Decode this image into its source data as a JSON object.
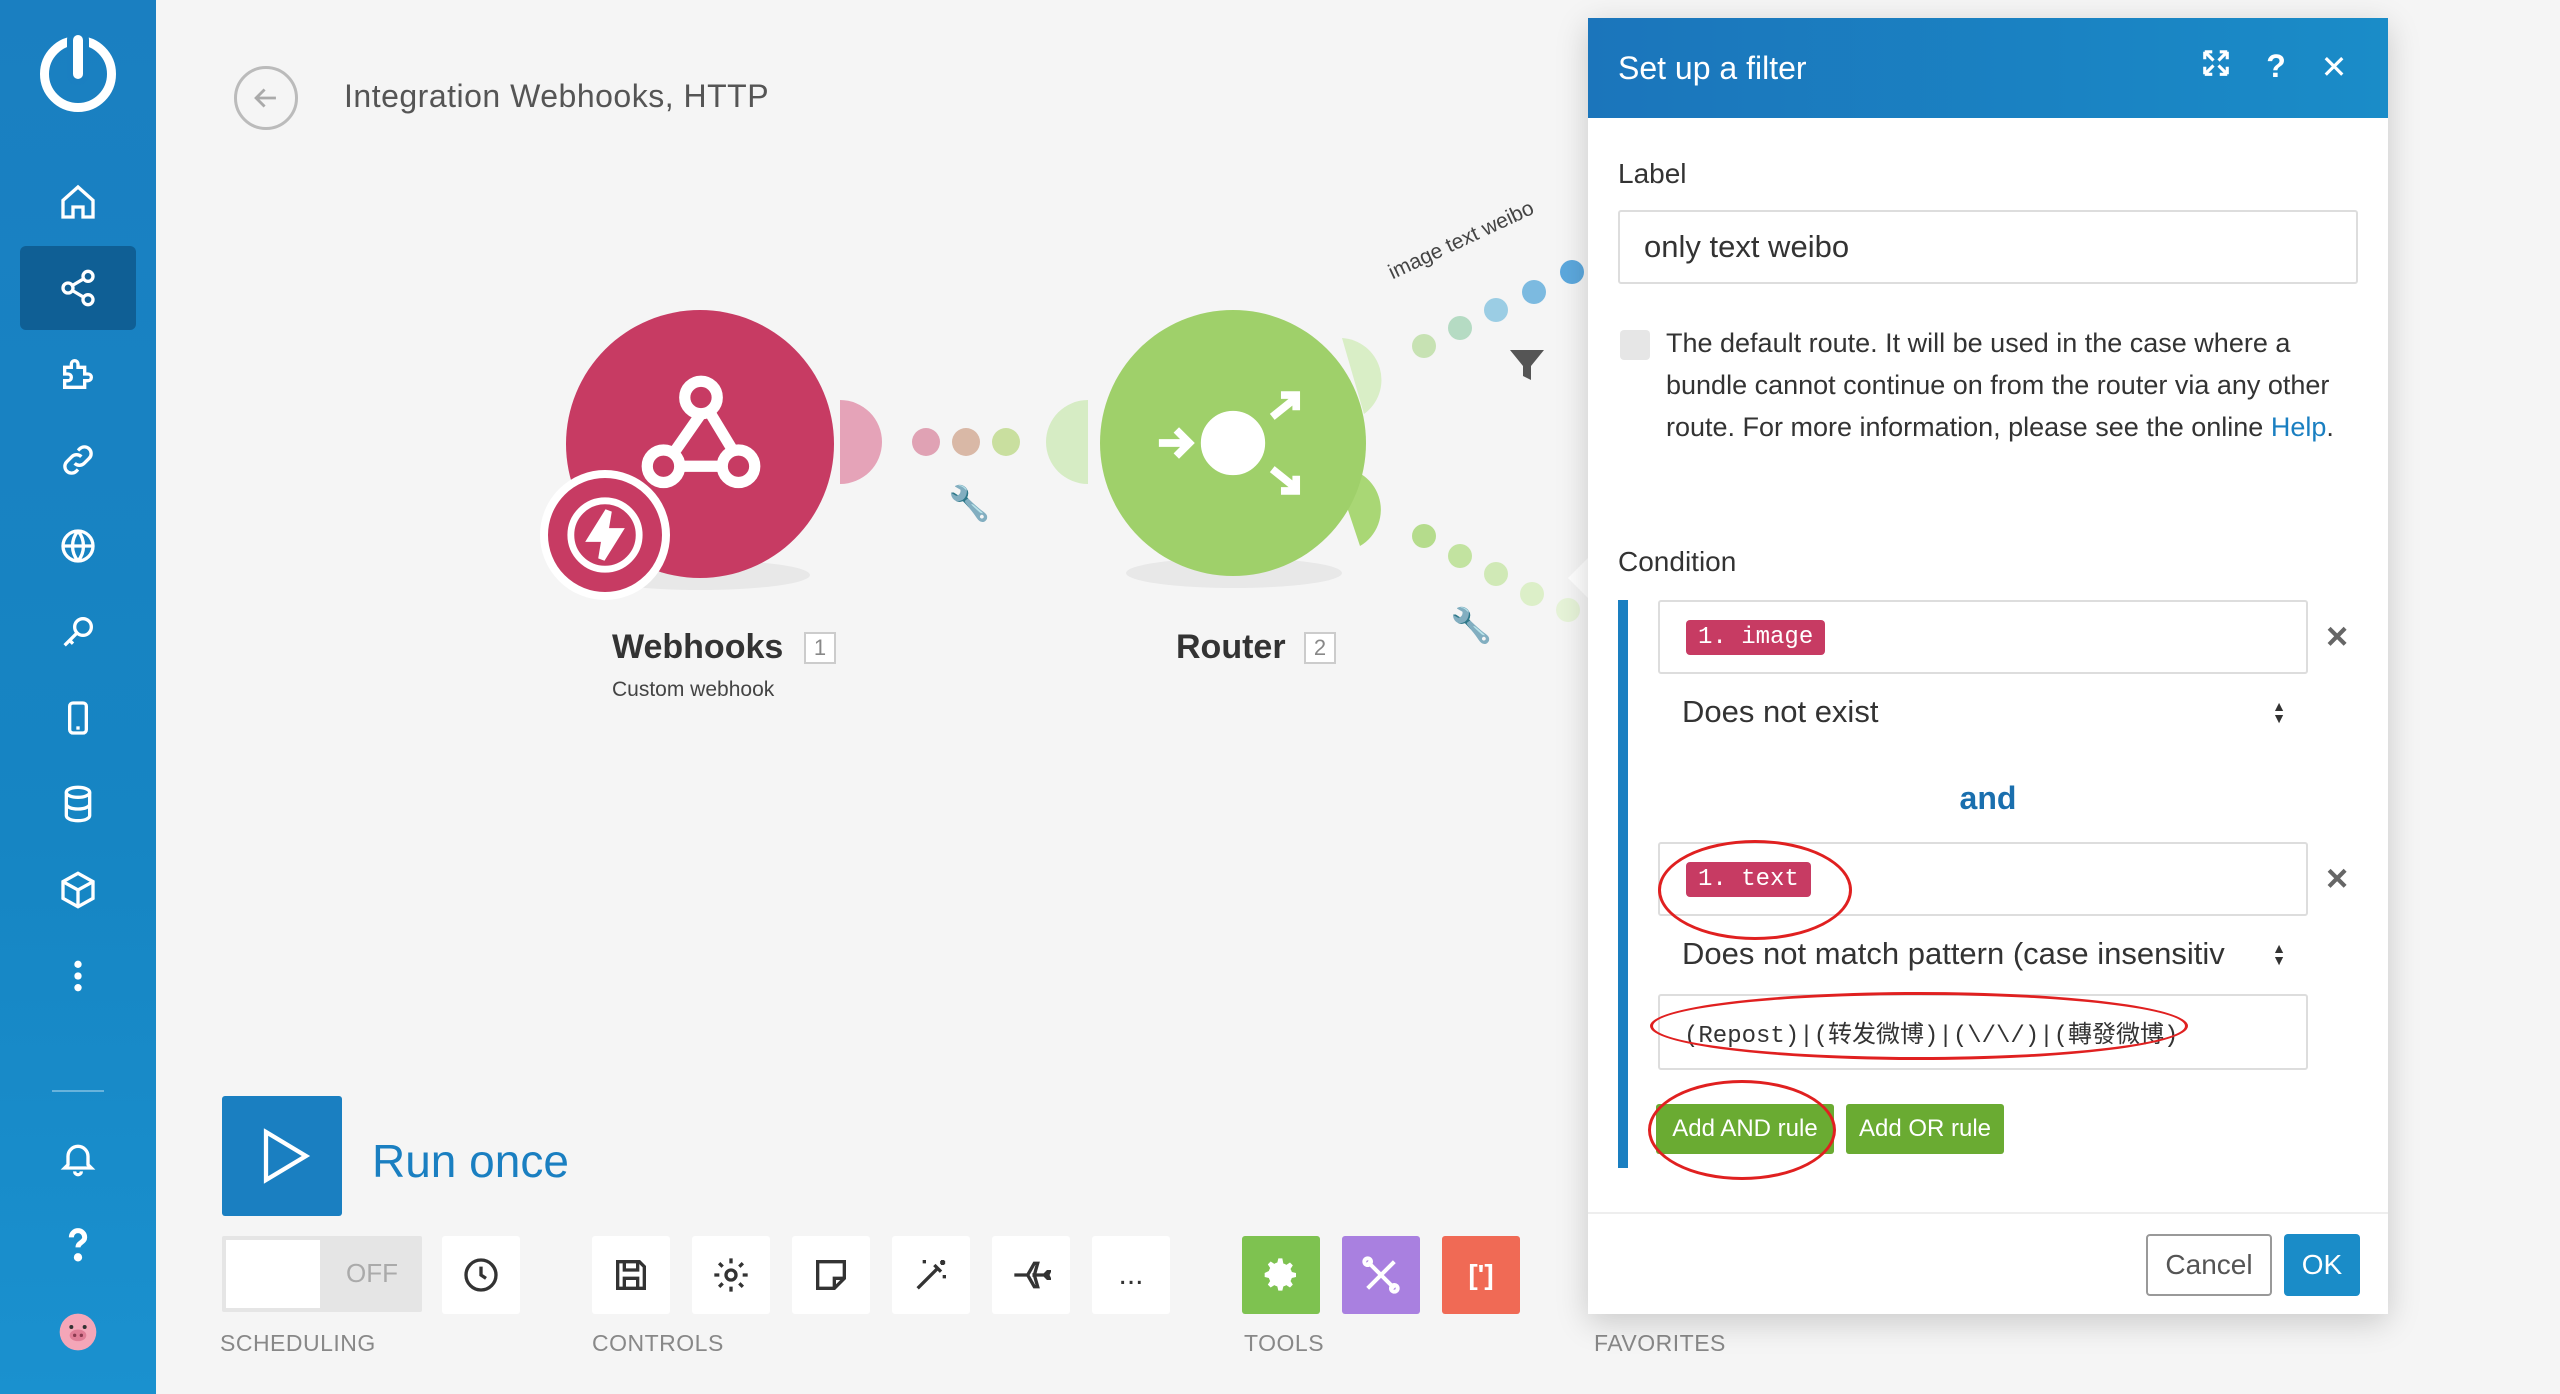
{
  "app": {
    "scenario_title": "Integration Webhooks, HTTP"
  },
  "sidebar": {
    "items": [
      {
        "icon": "home-icon"
      },
      {
        "icon": "share-icon",
        "active": true
      },
      {
        "icon": "puzzle-icon"
      },
      {
        "icon": "link-icon"
      },
      {
        "icon": "globe-icon"
      },
      {
        "icon": "key-icon"
      },
      {
        "icon": "mobile-icon"
      },
      {
        "icon": "database-icon"
      },
      {
        "icon": "cube-icon"
      },
      {
        "icon": "more-vertical-icon"
      },
      {
        "icon": "bell-icon"
      },
      {
        "icon": "question-icon"
      },
      {
        "icon": "avatar-icon"
      }
    ]
  },
  "canvas": {
    "webhook_node": {
      "label": "Webhooks",
      "number": "1",
      "subtitle": "Custom webhook",
      "color": "#c73b63"
    },
    "router_node": {
      "label": "Router",
      "number": "2",
      "color": "#9fd06a"
    },
    "route_label": "image text weibo"
  },
  "run": {
    "label": "Run once"
  },
  "toolbar": {
    "scheduling_toggle": "OFF",
    "scheduling_label": "SCHEDULING",
    "controls_label": "CONTROLS",
    "tools_label": "TOOLS",
    "favorites_label": "FAVORITES",
    "more_label": "..."
  },
  "modal": {
    "title": "Set up a filter",
    "label_caption": "Label",
    "label_value": "only text weibo",
    "default_route_text": "The default route. It will be used in the case where a bundle cannot continue on from the router via any other route. For more information, please see the online ",
    "help_link": "Help",
    "help_suffix": ".",
    "condition_caption": "Condition",
    "rule1": {
      "field": "1. image",
      "operator": "Does not exist"
    },
    "and_label": "and",
    "rule2": {
      "field": "1. text",
      "operator": "Does not match pattern (case insensitiv",
      "pattern": "(Repost)|(转发微博)|(\\/\\/)|(轉發微博)"
    },
    "add_and_rule": "Add AND rule",
    "add_or_rule": "Add OR rule",
    "cancel": "Cancel",
    "ok": "OK"
  },
  "colors": {
    "accent": "#1a7fc1",
    "green": "#6aab32",
    "pill": "#c73b63"
  }
}
